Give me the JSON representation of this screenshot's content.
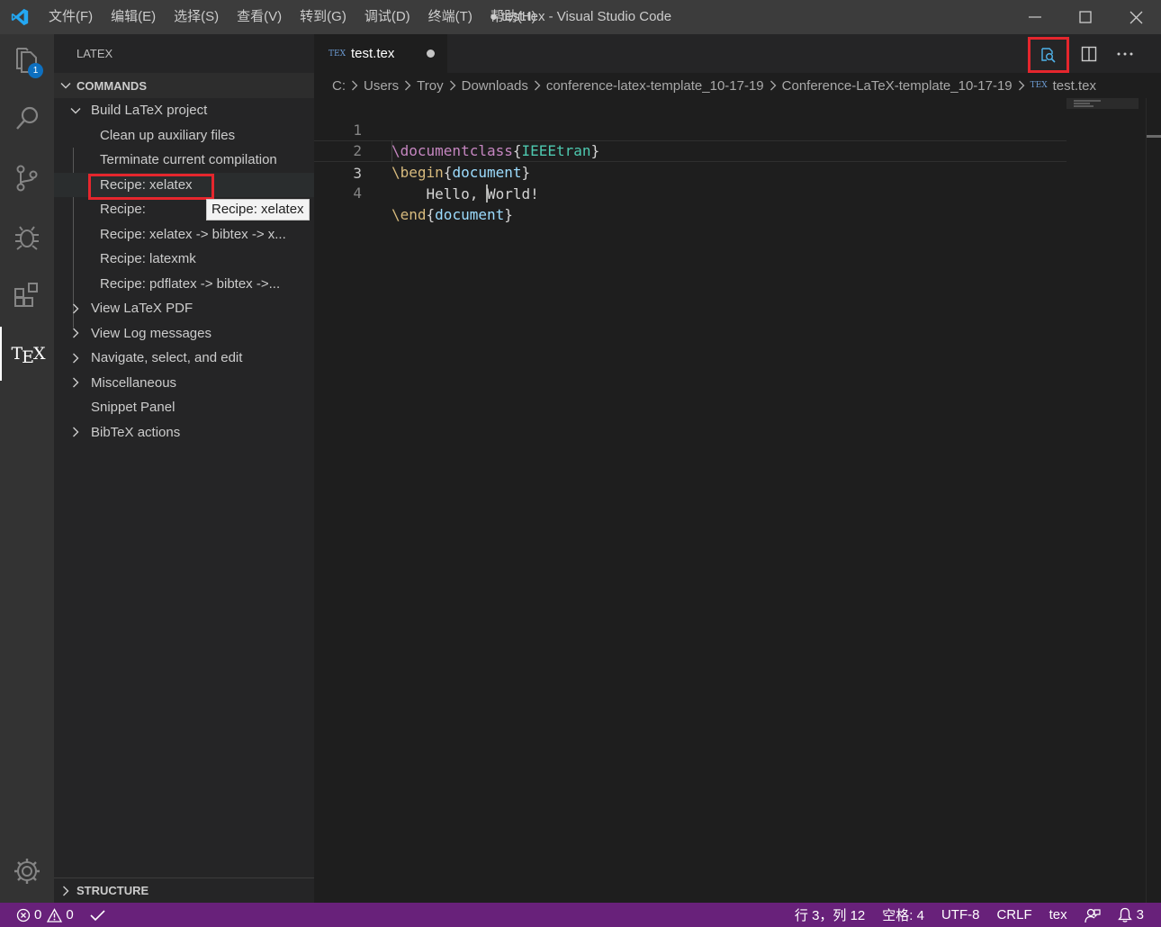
{
  "window": {
    "title": "● test.tex - Visual Studio Code",
    "menu": [
      "文件(F)",
      "编辑(E)",
      "选择(S)",
      "查看(V)",
      "转到(G)",
      "调试(D)",
      "终端(T)",
      "帮助(H)"
    ]
  },
  "activity": {
    "explorer_badge": "1",
    "tex_label_t": "T",
    "tex_label_e": "E",
    "tex_label_x": "X"
  },
  "sidebar": {
    "title": "LATEX",
    "commands_header": "COMMANDS",
    "items": [
      {
        "label": "Build LaTeX project"
      },
      {
        "label": "Clean up auxiliary files"
      },
      {
        "label": "Terminate current compilation"
      },
      {
        "label": "Recipe: xelatex"
      },
      {
        "label": "Recipe: "
      },
      {
        "label": "Recipe: xelatex -> bibtex -> x..."
      },
      {
        "label": "Recipe: latexmk"
      },
      {
        "label": "Recipe: pdflatex -> bibtex ->..."
      },
      {
        "label": "View LaTeX PDF"
      },
      {
        "label": "View Log messages"
      },
      {
        "label": "Navigate, select, and edit"
      },
      {
        "label": "Miscellaneous"
      },
      {
        "label": "Snippet Panel"
      },
      {
        "label": "BibTeX actions"
      }
    ],
    "tooltip": "Recipe: xelatex",
    "structure_header": "STRUCTURE"
  },
  "editor": {
    "tab": {
      "icon_text": "TEX",
      "name": "test.tex"
    },
    "breadcrumb": [
      "C:",
      "Users",
      "Troy",
      "Downloads",
      "conference-latex-template_10-17-19",
      "Conference-LaTeX-template_10-17-19"
    ],
    "breadcrumb_file": "test.tex",
    "lines": [
      {
        "num": "1",
        "cmd": "\\documentclass",
        "open": "{",
        "arg": "IEEEtran",
        "close": "}"
      },
      {
        "num": "2",
        "cmd": "\\begin",
        "open": "{",
        "arg": "document",
        "close": "}"
      },
      {
        "num": "3",
        "text_before_cursor": "    Hello, ",
        "text_after_cursor": "World!"
      },
      {
        "num": "4",
        "cmd": "\\end",
        "open": "{",
        "arg": "document",
        "close": "}"
      }
    ]
  },
  "statusbar": {
    "errors": "0",
    "warnings": "0",
    "position": "行 3，列 12",
    "indent": "空格: 4",
    "encoding": "UTF-8",
    "eol": "CRLF",
    "language": "tex",
    "notifications": "3"
  },
  "colors": {
    "statusbar_bg": "#68217a",
    "highlight": "#e5262d",
    "keyword": "#c586c0",
    "class_arg": "#4ec9b0",
    "env_arg": "#9cdcfe"
  }
}
